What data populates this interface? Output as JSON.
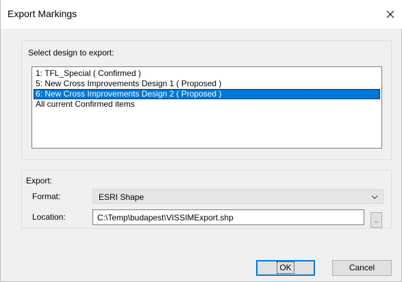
{
  "window": {
    "title": "Export Markings"
  },
  "select_group": {
    "label": "Select design to export:",
    "items": [
      {
        "label": "1: TFL_Special ( Confirmed )",
        "selected": false
      },
      {
        "label": "5: New Cross Improvements Design 1 ( Proposed )",
        "selected": false
      },
      {
        "label": "6: New Cross Improvements Design 2 ( Proposed )",
        "selected": true
      },
      {
        "label": "All current Confirmed items",
        "selected": false
      }
    ]
  },
  "export_group": {
    "label": "Export:",
    "format_label": "Format:",
    "format_value": "ESRI Shape",
    "location_label": "Location:",
    "location_value": "C:\\Temp\\budapest\\VISSIMExport.shp",
    "browse_label": ".."
  },
  "buttons": {
    "ok": "OK",
    "cancel": "Cancel"
  },
  "colors": {
    "selection": "#0078d7",
    "dialog_bg": "#f0f0f0"
  }
}
